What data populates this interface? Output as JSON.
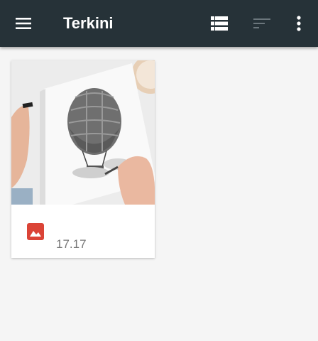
{
  "appbar": {
    "title": "Terkini",
    "background": "#263238",
    "icons": {
      "menu": "menu-icon",
      "view": "view-list-icon",
      "sort": "sort-icon",
      "more": "more-vert-icon"
    }
  },
  "items": [
    {
      "thumbnail": "hot-air-balloon-sketch-image",
      "type_icon": "image-icon",
      "type_color": "#db4437",
      "time": "17.17"
    }
  ]
}
